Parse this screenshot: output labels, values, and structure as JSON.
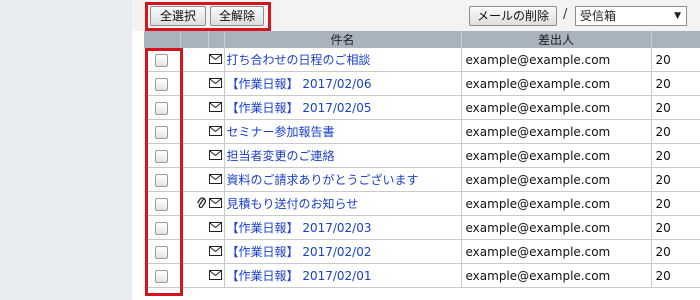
{
  "toolbar": {
    "select_all_label": "全選択",
    "deselect_all_label": "全解除",
    "delete_mail_label": "メールの削除",
    "separator": "/",
    "folder_selected": "受信箱"
  },
  "table": {
    "columns": {
      "subject": "件名",
      "sender": "差出人"
    },
    "rows": [
      {
        "subject": "打ち合わせの日程のご相談",
        "sender": "example@example.com",
        "date": "20",
        "attachment": false
      },
      {
        "subject": "【作業日報】 2017/02/06",
        "sender": "example@example.com",
        "date": "20",
        "attachment": false
      },
      {
        "subject": "【作業日報】 2017/02/05",
        "sender": "example@example.com",
        "date": "20",
        "attachment": false
      },
      {
        "subject": "セミナー参加報告書",
        "sender": "example@example.com",
        "date": "20",
        "attachment": false
      },
      {
        "subject": "担当者変更のご連絡",
        "sender": "example@example.com",
        "date": "20",
        "attachment": false
      },
      {
        "subject": "資料のご請求ありがとうございます",
        "sender": "example@example.com",
        "date": "20",
        "attachment": false
      },
      {
        "subject": "見積もり送付のお知らせ",
        "sender": "example@example.com",
        "date": "20",
        "attachment": true
      },
      {
        "subject": "【作業日報】 2017/02/03",
        "sender": "example@example.com",
        "date": "20",
        "attachment": false
      },
      {
        "subject": "【作業日報】 2017/02/02",
        "sender": "example@example.com",
        "date": "20",
        "attachment": false
      },
      {
        "subject": "【作業日報】 2017/02/01",
        "sender": "example@example.com",
        "date": "20",
        "attachment": false
      }
    ]
  },
  "colors": {
    "highlight": "#d7141e",
    "subject_link": "#1a3fcf",
    "header_bg": "#a9b3bd",
    "sidebar_bg": "#e9edf2"
  },
  "icons": {
    "envelope": "envelope-icon",
    "attachment": "paperclip-icon"
  }
}
